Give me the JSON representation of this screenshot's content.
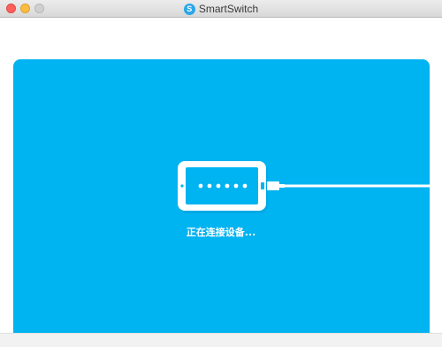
{
  "window": {
    "title": "SmartSwitch",
    "app_icon_letter": "S"
  },
  "colors": {
    "accent": "#00b3f1",
    "close": "#fc605c",
    "minimize": "#fdbc40",
    "maximize": "#d0d0d0"
  },
  "main": {
    "status": "正在连接设备...",
    "device_icon": "phone-with-cable-icon"
  }
}
